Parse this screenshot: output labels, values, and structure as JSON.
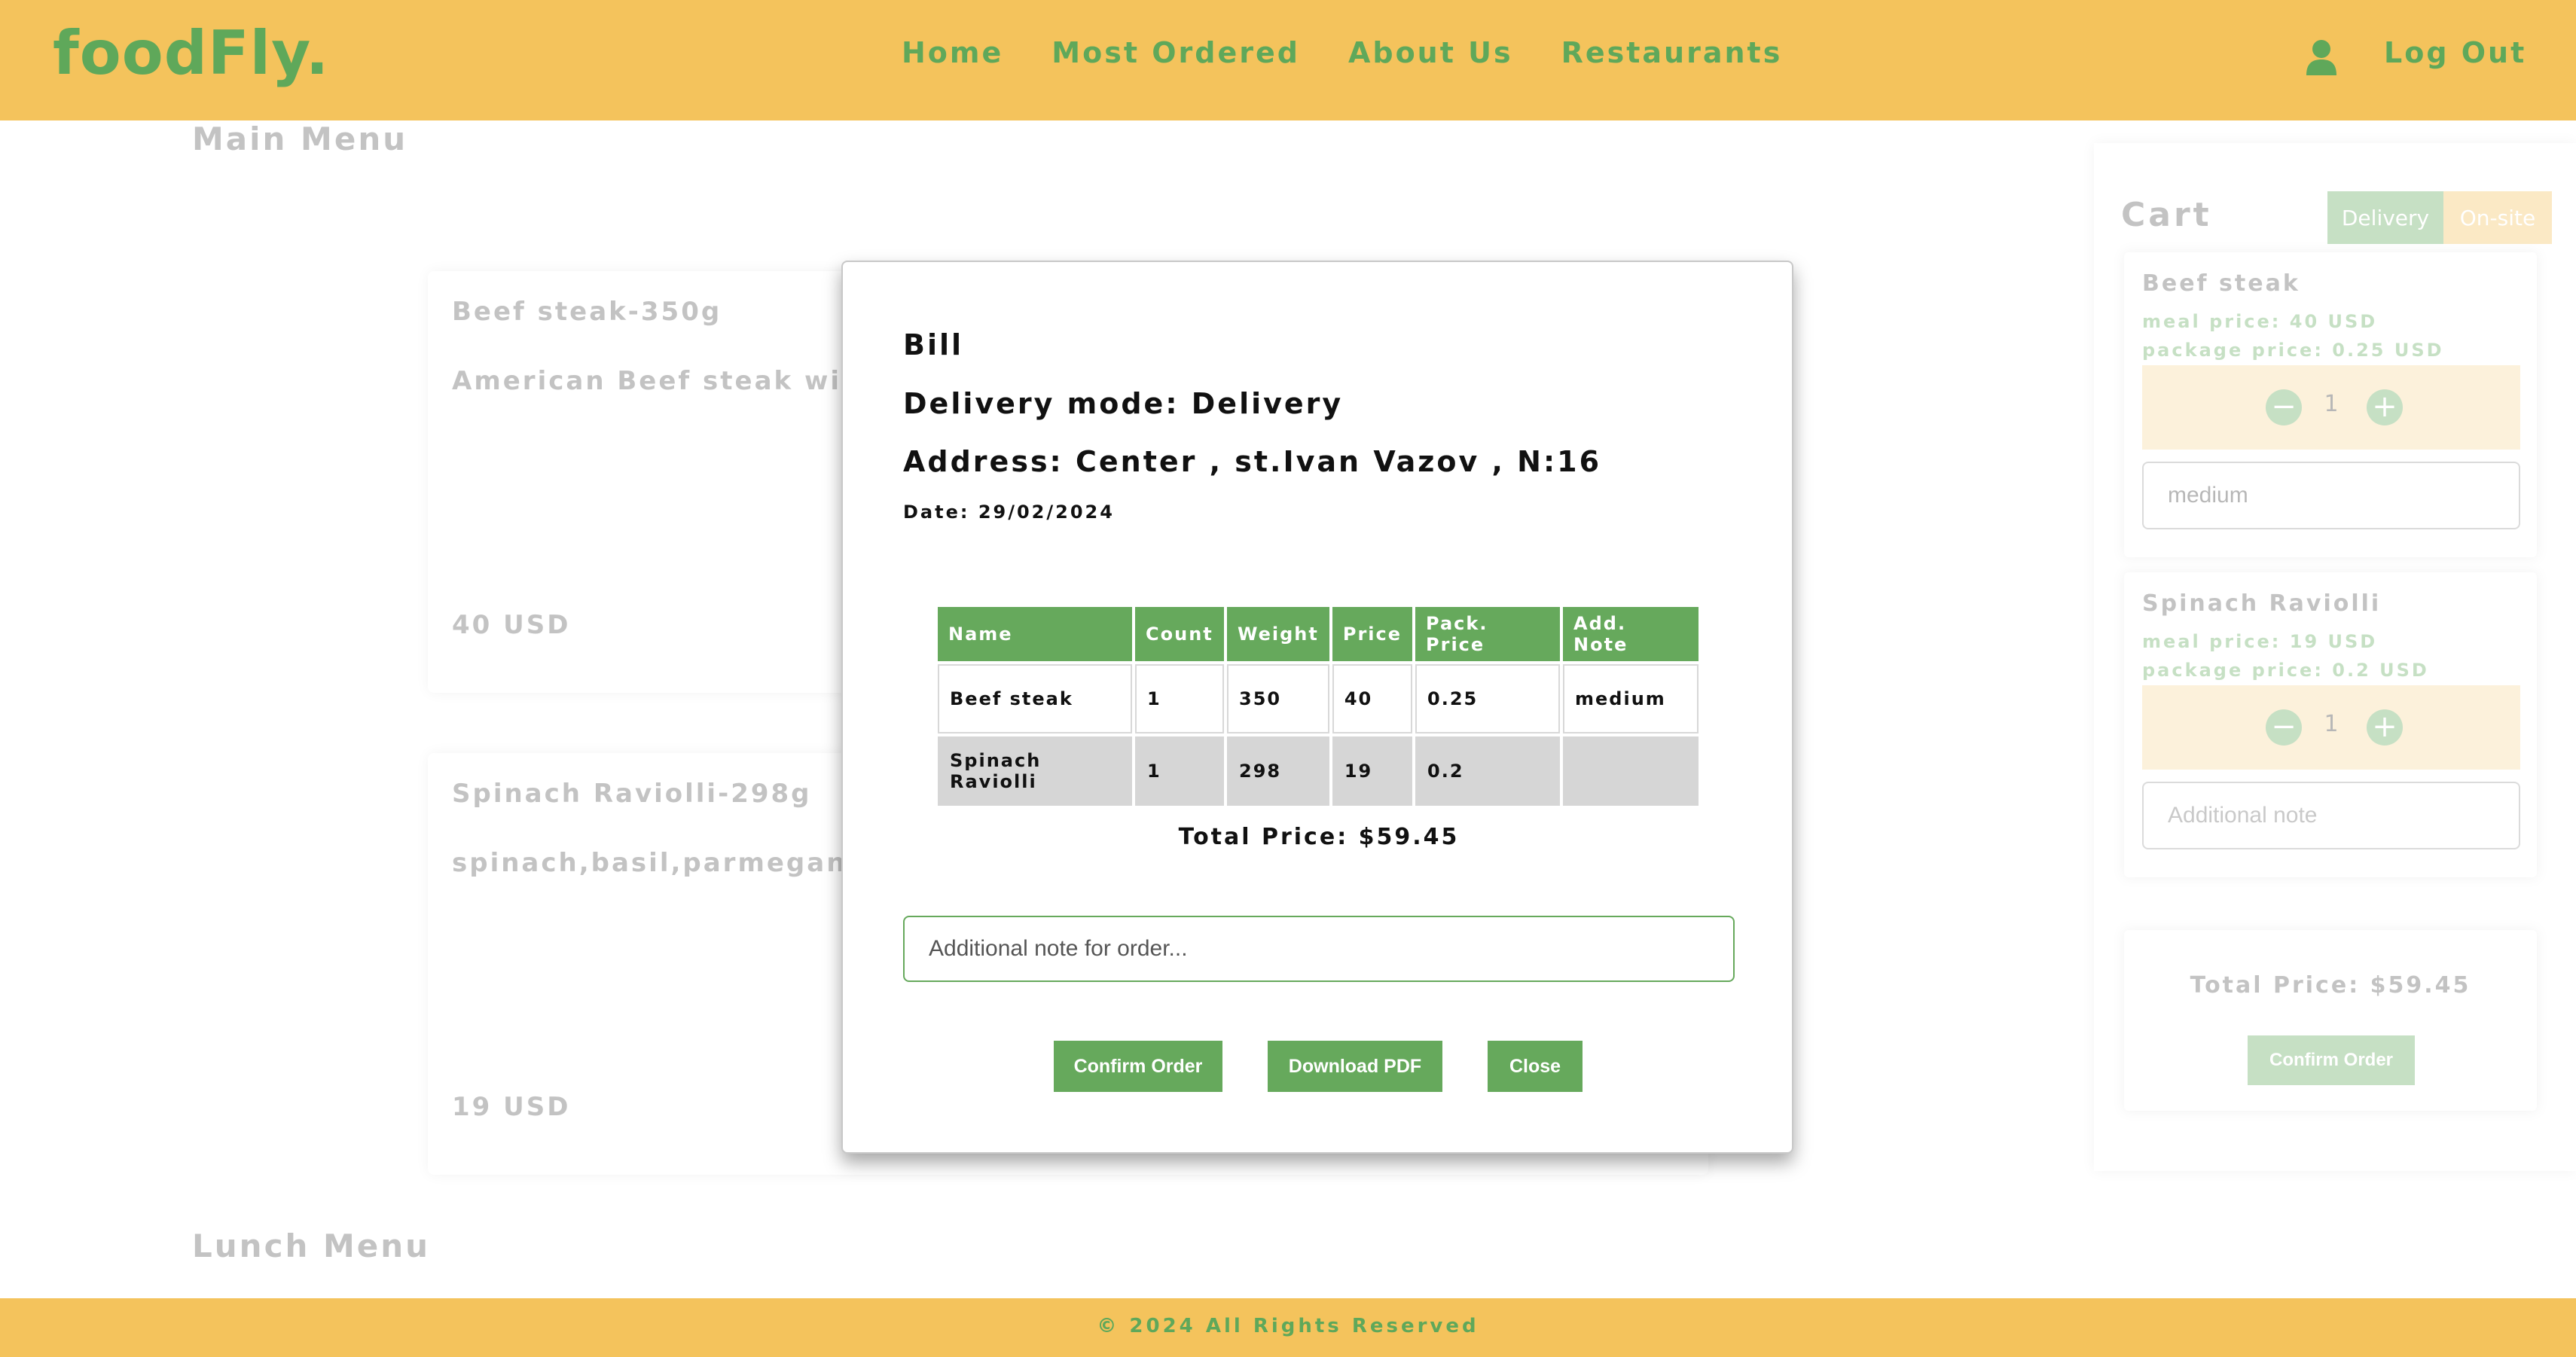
{
  "header": {
    "logo": "foodFly.",
    "nav": [
      "Home",
      "Most Ordered",
      "About Us",
      "Restaurants"
    ],
    "logout": "Log Out"
  },
  "page": {
    "main_menu_title": "Main Menu",
    "lunch_menu_title": "Lunch Menu",
    "menu_cards": [
      {
        "name": "Beef steak-350g",
        "description": "American Beef steak with f",
        "price": "40 USD"
      },
      {
        "name": "Spinach Raviolli-298g",
        "description": "spinach,basil,parmegano,c",
        "price": "19 USD"
      }
    ]
  },
  "cart": {
    "title": "Cart",
    "toggle_delivery": "Delivery",
    "toggle_onsite": "On-site",
    "items": [
      {
        "name": "Beef steak",
        "meal_price": "meal price: 40 USD",
        "package_price": "package price: 0.25 USD",
        "qty": "1",
        "note_value": "medium",
        "note_placeholder": "Additional note"
      },
      {
        "name": "Spinach Raviolli",
        "meal_price": "meal price: 19 USD",
        "package_price": "package price: 0.2 USD",
        "qty": "1",
        "note_value": "",
        "note_placeholder": "Additional note"
      }
    ],
    "total": "Total Price: $59.45",
    "confirm": "Confirm Order"
  },
  "footer": {
    "text": "© 2024 All Rights Reserved"
  },
  "modal": {
    "title": "Bill",
    "delivery_mode": "Delivery mode: Delivery",
    "address": "Address: Center , st.Ivan Vazov , N:16",
    "date": "Date: 29/02/2024",
    "table": {
      "headers": [
        "Name",
        "Count",
        "Weight",
        "Price",
        "Pack. Price",
        "Add. Note"
      ],
      "rows": [
        [
          "Beef steak",
          "1",
          "350",
          "40",
          "0.25",
          "medium"
        ],
        [
          "Spinach Raviolli",
          "1",
          "298",
          "19",
          "0.2",
          ""
        ]
      ]
    },
    "total": "Total Price: $59.45",
    "note_placeholder": "Additional note for order...",
    "buttons": {
      "confirm": "Confirm Order",
      "pdf": "Download PDF",
      "close": "Close"
    }
  },
  "colors": {
    "brand_yellow": "#f4c35c",
    "brand_green": "#5fa85a"
  }
}
